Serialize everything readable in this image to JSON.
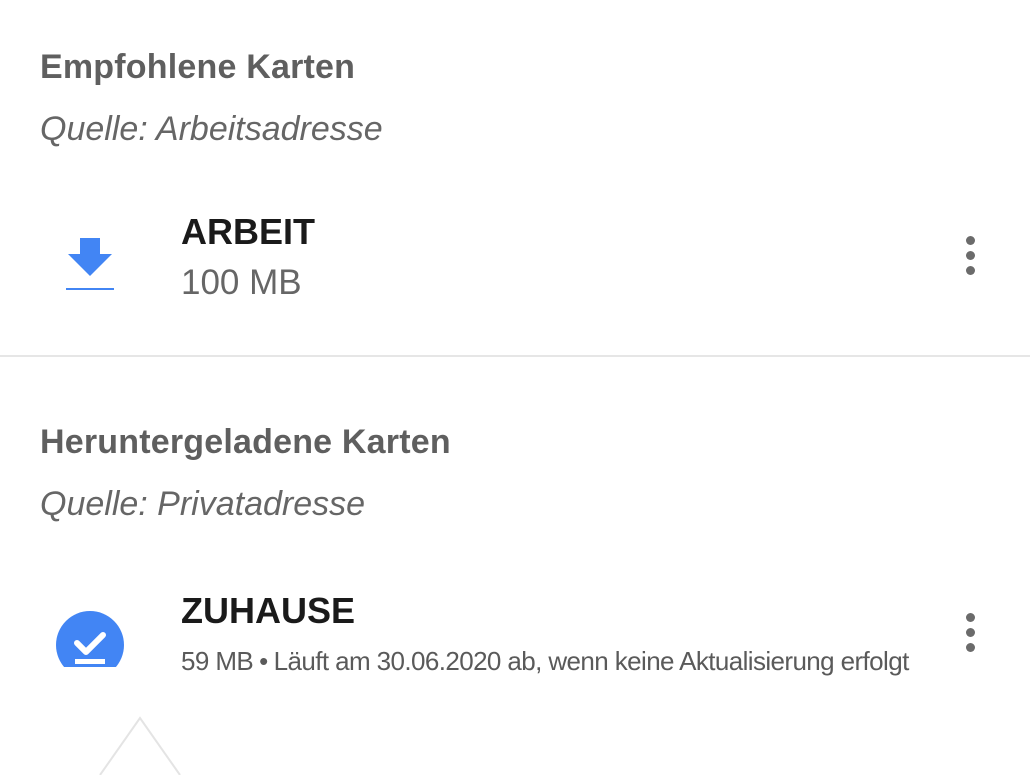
{
  "recommended": {
    "title": "Empfohlene Karten",
    "source": "Quelle: Arbeitsadresse",
    "item": {
      "name": "ARBEIT",
      "size": "100 MB",
      "icon": "download-icon"
    }
  },
  "downloaded": {
    "title": "Heruntergeladene Karten",
    "source": "Quelle: Privatadresse",
    "item": {
      "name": "ZUHAUSE",
      "size": "59 MB",
      "separator": "•",
      "expiry": "Läuft am 30.06.2020 ab, wenn keine Aktualisierung erfolgt",
      "icon": "download-done-icon"
    }
  },
  "colors": {
    "accent": "#4285f4",
    "title": "#5f5f5f",
    "item_name": "#1a1a1a",
    "secondary_text": "#666666",
    "divider": "#e6e6e6",
    "overflow_icon": "#6b6b6b"
  },
  "icons": {
    "overflow": "more-vert-icon"
  }
}
